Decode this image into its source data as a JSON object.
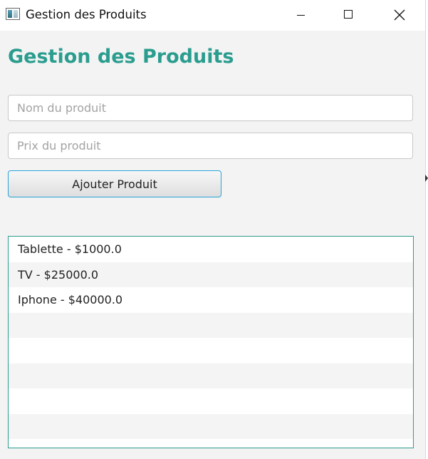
{
  "window": {
    "title": "Gestion des Produits",
    "controls": [
      "minimize-icon",
      "maximize-icon",
      "close-icon"
    ]
  },
  "main": {
    "heading": "Gestion des Produits",
    "name_field": {
      "placeholder": "Nom du produit",
      "value": ""
    },
    "price_field": {
      "placeholder": "Prix du produit",
      "value": ""
    },
    "add_button_label": "Ajouter Produit",
    "product_list": {
      "items": [
        "Tablette - $1000.0",
        "TV - $25000.0",
        "Iphone - $40000.0"
      ]
    }
  },
  "colors": {
    "accent": "#2a9d8f",
    "button_focus": "#29a3d8",
    "window_bg": "#f3f3f3"
  }
}
